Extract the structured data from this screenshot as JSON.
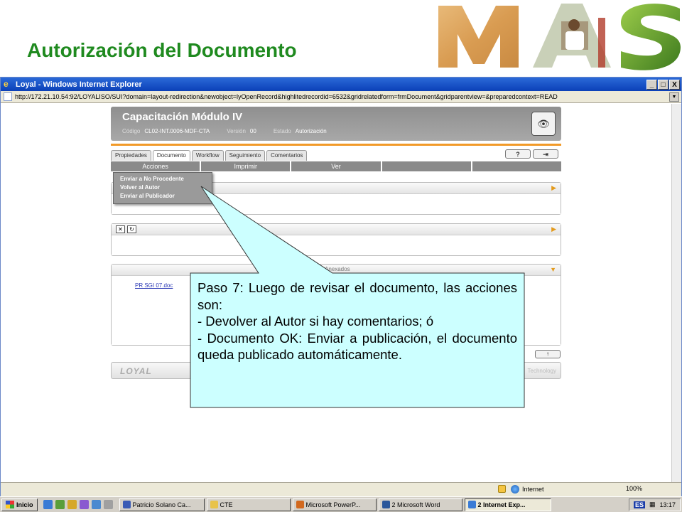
{
  "slide": {
    "title": "Autorización del Documento",
    "logo_text": "MAS"
  },
  "browser": {
    "window_title": "Loyal - Windows Internet Explorer",
    "window_buttons": [
      "_",
      "□",
      "X"
    ],
    "url": "http://172.21.10.54:92/LOYALISO/SUI?domain=layout-redirection&newobject=lyOpenRecord&highlitedrecordid=6532&gridrelatedform=frmDocument&gridparentview=&preparedcontext=READ",
    "status_zone": "Internet",
    "zoom": "100%"
  },
  "app": {
    "title": "Capacitación Módulo IV",
    "meta": {
      "codigo_label": "Código",
      "codigo_value": "CL02-INT.0006-MDF-CTA",
      "version_label": "Versión",
      "version_value": "00",
      "estado_label": "Estado",
      "estado_value": "Autorización"
    },
    "tabs": [
      "Propiedades",
      "Documento",
      "Workflow",
      "Seguimiento",
      "Comentarios"
    ],
    "help_buttons": [
      "?",
      "⇥"
    ],
    "menu": [
      "Acciones",
      "Imprimir",
      "Ver",
      "",
      ""
    ],
    "dropdown": [
      "Enviar a No Procedente",
      "Volver al Autor",
      "Enviar al Publicador"
    ],
    "attachments_label": "Anexados",
    "doc_link": "PR SGI 07.doc",
    "footer_brand": "LOYAL",
    "footer_tech": "Technology"
  },
  "callout": {
    "lines": [
      "Paso 7: Luego de revisar el documento, las acciones son:",
      "- Devolver al Autor si hay comentarios; ó",
      "- Documento OK: Enviar a publicación, el documento queda publicado automáticamente."
    ]
  },
  "taskbar": {
    "start": "Inicio",
    "tasks": [
      "Patricio Solano Ca...",
      "CTE",
      "Microsoft PowerP...",
      "2 Microsoft Word",
      "2 Internet Exp..."
    ],
    "language": "ES",
    "clock": "13:17"
  },
  "colors": {
    "title_green": "#1f8a1f",
    "callout_fill": "#ccffff",
    "accent_orange": "#f29a28"
  }
}
